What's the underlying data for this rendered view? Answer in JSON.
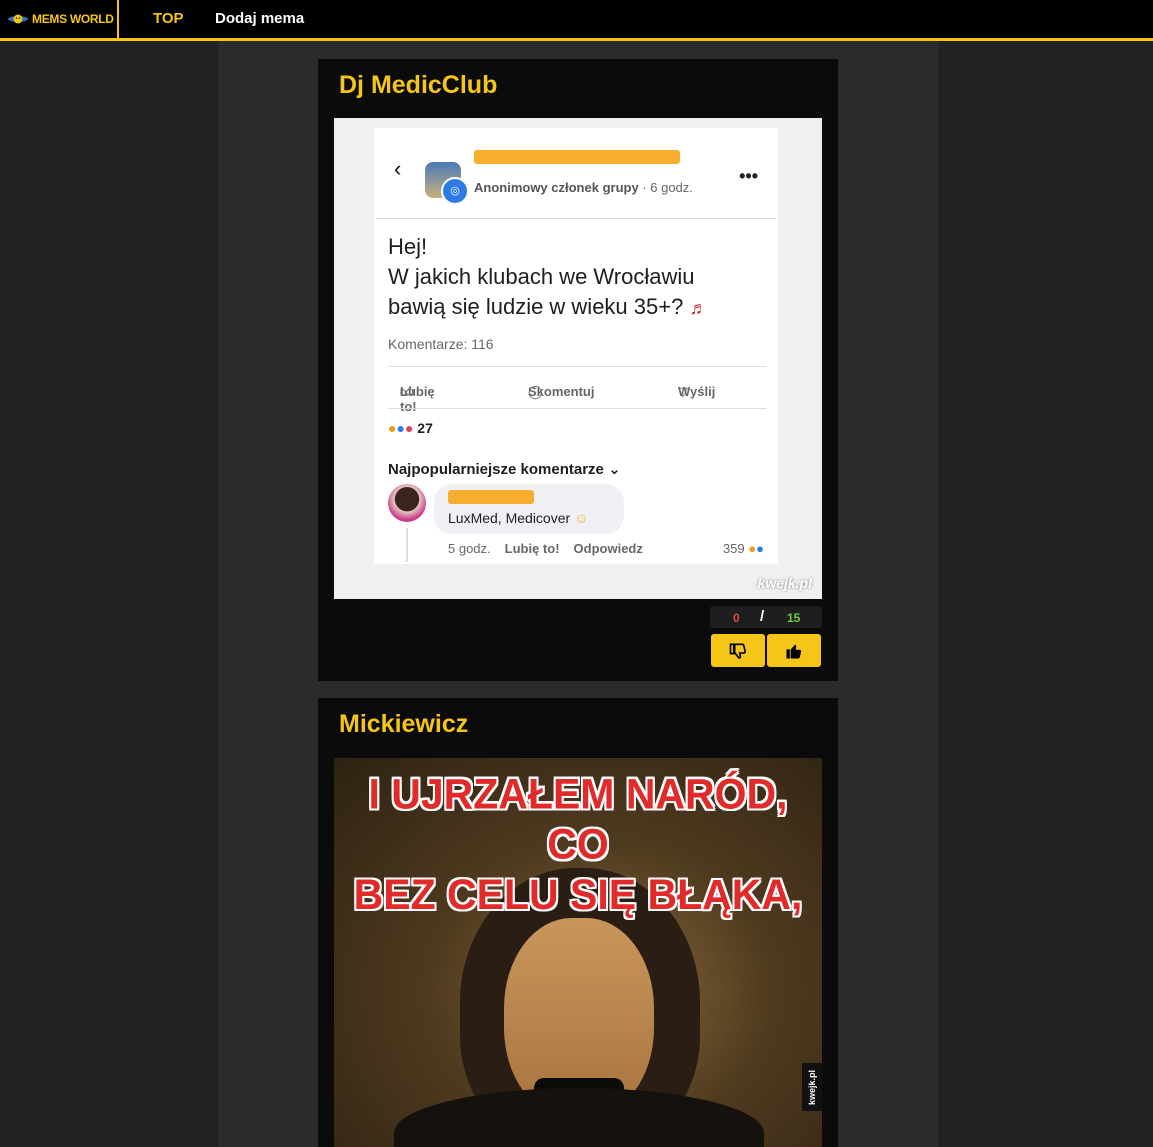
{
  "nav": {
    "brand": "MEMS WORLD",
    "items": [
      "TOP",
      "Dodaj mema"
    ]
  },
  "posts": [
    {
      "title": "Dj MedicClub",
      "image": {
        "group_meta_label": "Anonimowy członek grupy",
        "group_meta_time": "· 6 godz.",
        "post_text_1": "Hej!",
        "post_text_2": "W jakich klubach we Wrocławiu",
        "post_text_3": "bawią się ludzie w wieku 35+?",
        "comments_count": "Komentarze: 116",
        "action_like": "Lubię to!",
        "action_comment": "Skomentuj",
        "action_send": "Wyślij",
        "reactions_count": "27",
        "popular_comments": "Najpopularniejsze komentarze",
        "comment_text": "LuxMed, Medicover",
        "comment_time": "5 godz.",
        "comment_like": "Lubię to!",
        "comment_reply": "Odpowiedz",
        "comment_reactions": "359",
        "watermark": "kwejk.pl"
      },
      "downvotes": "0",
      "separator": "/",
      "upvotes": "15"
    },
    {
      "title": "Mickiewicz",
      "image": {
        "caption_line1": "I UJRZAŁEM NARÓD, CO",
        "caption_line2": "BEZ CELU SIĘ BŁĄKA,",
        "watermark": "kwejk.pl"
      }
    }
  ],
  "colors": {
    "accent": "#f5c518",
    "downvote": "#e04b3a",
    "upvote": "#6fcf3b"
  }
}
